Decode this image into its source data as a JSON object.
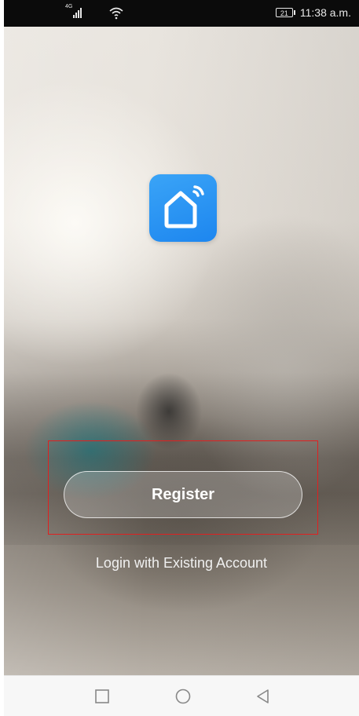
{
  "status_bar": {
    "network_label": "4G",
    "battery_level": "21",
    "time": "11:38 a.m."
  },
  "icons": {
    "signal": "signal-bars-icon",
    "wifi": "wifi-icon",
    "battery": "battery-icon",
    "app_logo": "smart-home-icon",
    "nav_recents": "square-icon",
    "nav_home": "circle-icon",
    "nav_back": "triangle-back-icon"
  },
  "colors": {
    "accent_blue": "#2a93f3",
    "highlight_red": "#e02020",
    "status_bar_bg": "#0b0b0b",
    "nav_bar_bg": "#f7f7f7"
  },
  "main": {
    "register_label": "Register",
    "login_label": "Login with Existing Account"
  }
}
